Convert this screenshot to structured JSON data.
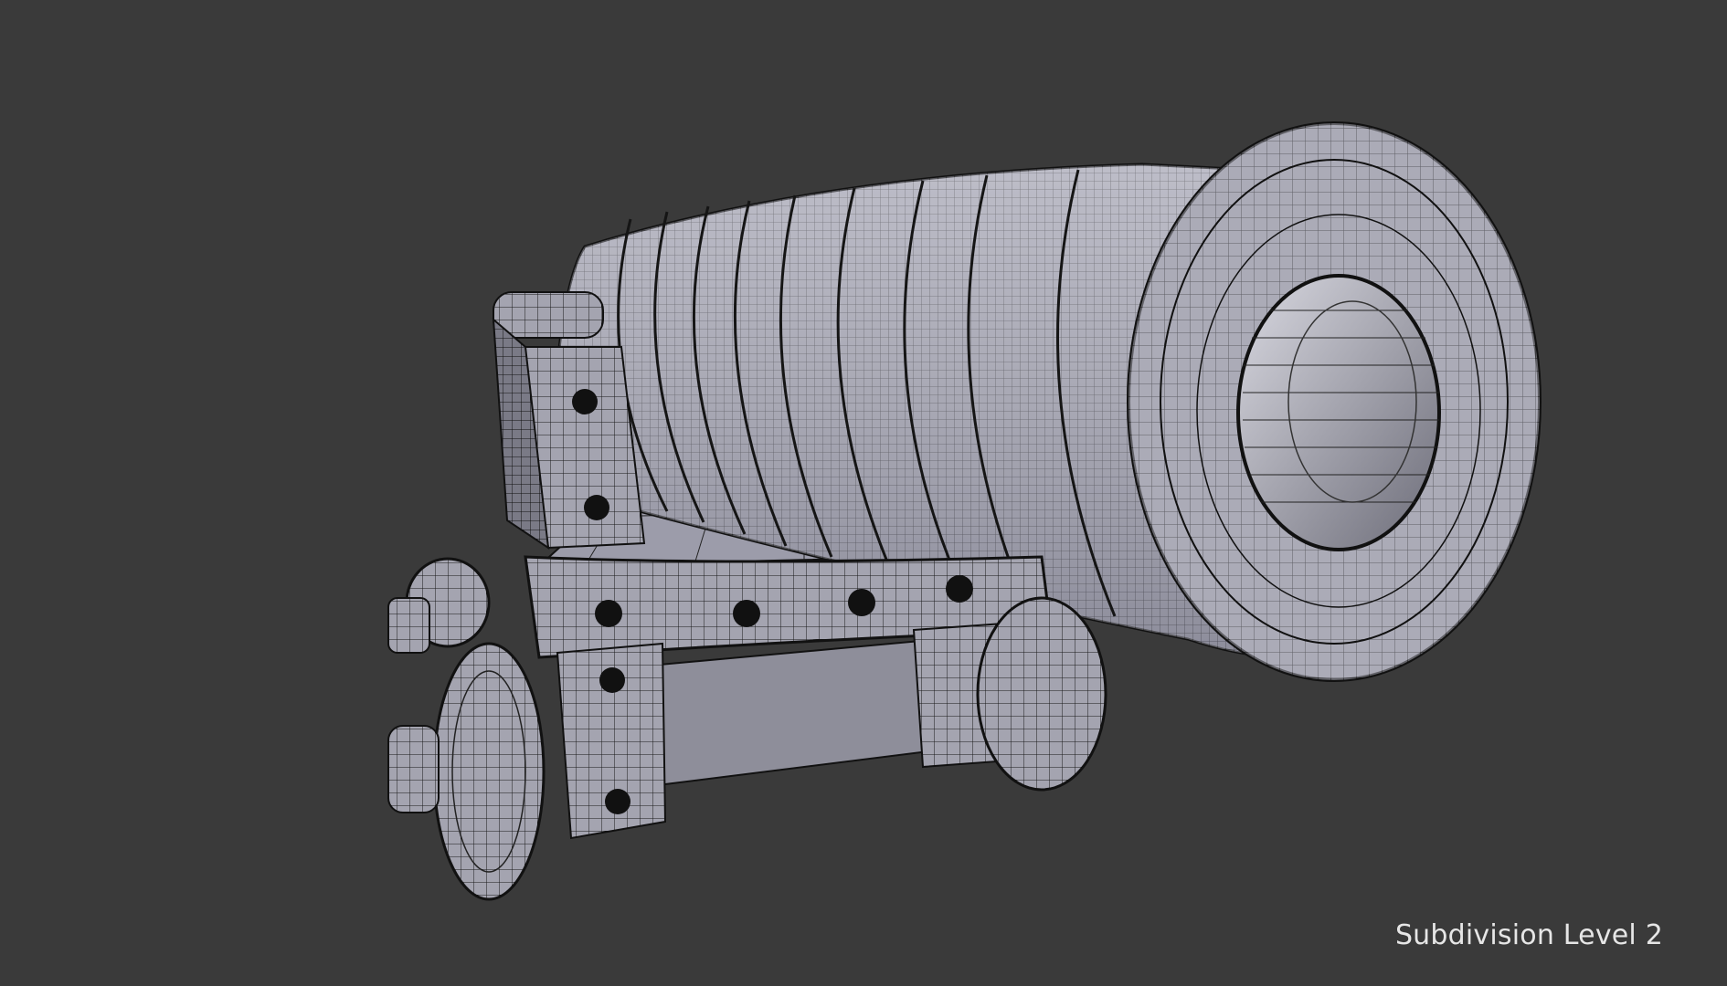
{
  "viewport": {
    "overlay_text": "Subdivision Level 2",
    "background_color": "#3a3a3a",
    "mesh_fill_color": "#a6a6b2",
    "mesh_wire_color": "#111111",
    "origin_marker_color": "#f0a030"
  },
  "model": {
    "parts": [
      "cannon-barrel",
      "barrel-muzzle",
      "barrel-bore",
      "carriage-bed",
      "carriage-cheek",
      "front-wheel",
      "rear-wheel",
      "axle",
      "bolt"
    ]
  }
}
